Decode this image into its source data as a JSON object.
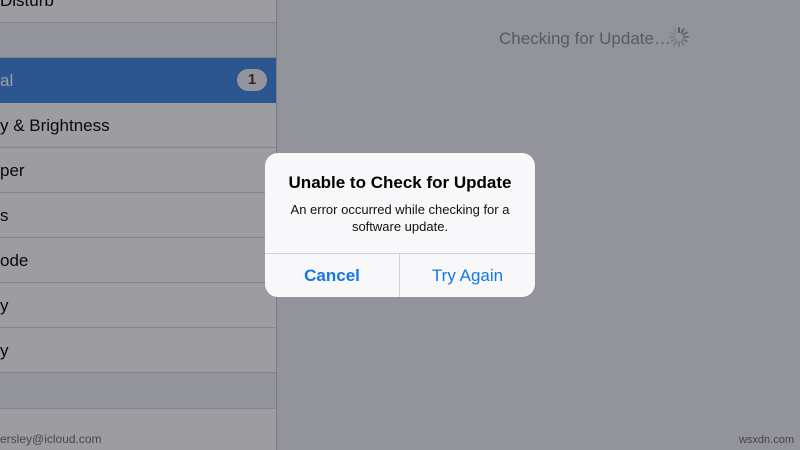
{
  "sidebar": {
    "rows_top": [
      {
        "label": "Disturb"
      }
    ],
    "selected": {
      "label": "al",
      "badge": "1"
    },
    "rows_main": [
      {
        "label": "y & Brightness"
      },
      {
        "label": "per"
      },
      {
        "label": "s"
      },
      {
        "label": "ode"
      },
      {
        "label": "y"
      },
      {
        "label": "y"
      }
    ],
    "account": "ersley@icloud.com"
  },
  "detail": {
    "status_text": "Checking for Update…",
    "spinner_icon": "activity-spinner-icon"
  },
  "alert": {
    "title": "Unable to Check for Update",
    "message": "An error occurred while checking for a software update.",
    "cancel_label": "Cancel",
    "retry_label": "Try Again"
  },
  "watermark": "wsxdn.com",
  "colors": {
    "selection": "#3f87e0",
    "button_text": "#1576e6"
  }
}
